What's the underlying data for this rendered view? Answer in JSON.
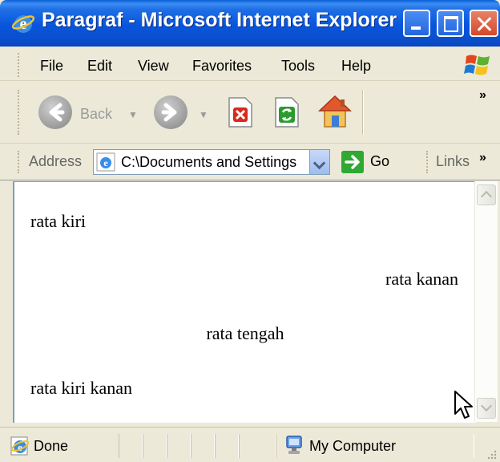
{
  "window": {
    "title": "Paragraf - Microsoft Internet Explorer"
  },
  "menu": {
    "items": [
      "File",
      "Edit",
      "View",
      "Favorites",
      "Tools",
      "Help"
    ]
  },
  "toolbar": {
    "back_label": "Back",
    "overflow_label": "»"
  },
  "address": {
    "label": "Address",
    "value": "C:\\Documents and Settings",
    "go_label": "Go",
    "links_label": "Links",
    "links_overflow": "»"
  },
  "content": {
    "paragraphs": {
      "left": "rata kiri",
      "right": "rata kanan",
      "center": "rata tengah",
      "justify": "rata kiri kanan"
    }
  },
  "status": {
    "text": "Done",
    "zone": "My Computer"
  },
  "colors": {
    "titlebar": "#0855dd",
    "chrome": "#ece9d8",
    "go_button": "#2fa834"
  }
}
